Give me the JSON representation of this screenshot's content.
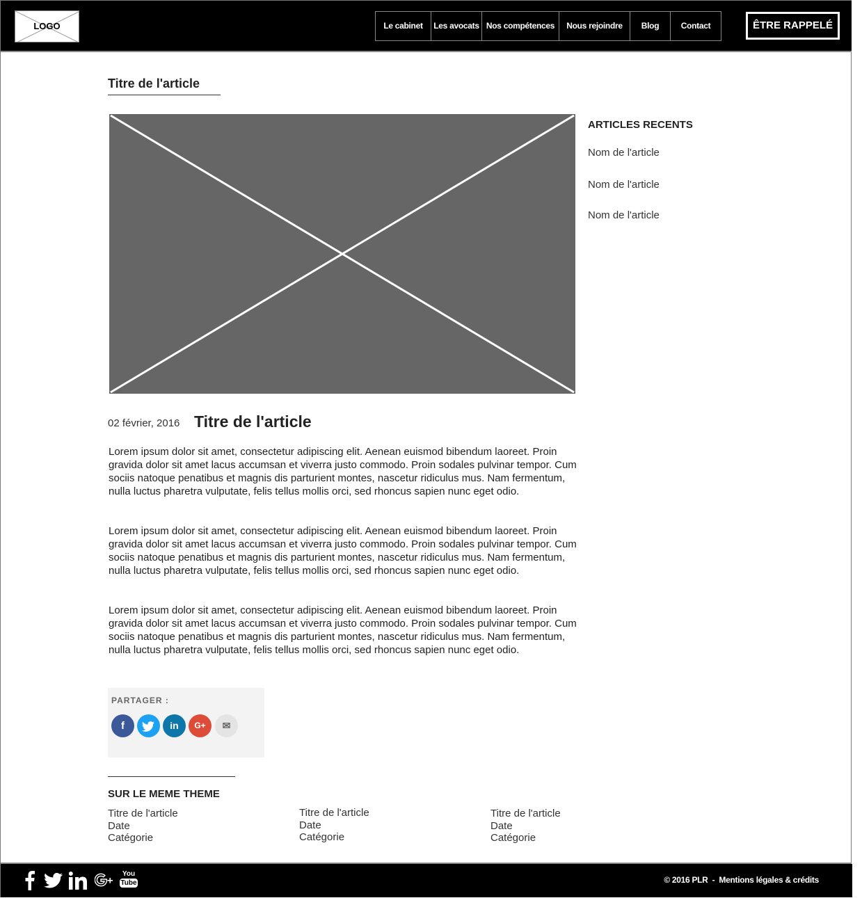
{
  "header": {
    "logo_text": "LOGO",
    "nav": [
      "Le cabinet",
      "Les avocats",
      "Nos compétences",
      "Nous rejoindre",
      "Blog",
      "Contact"
    ],
    "cta": "ÊTRE RAPPELÉ"
  },
  "page_title": "Titre de l'article",
  "sidebar": {
    "title": "ARTICLES RECENTS",
    "items": [
      "Nom de l'article",
      "Nom de l'article",
      "Nom de l'article"
    ]
  },
  "article": {
    "date": "02 février, 2016",
    "title": "Titre de l'article",
    "paragraphs": [
      "Lorem ipsum dolor sit amet, consectetur adipiscing elit. Aenean euismod bibendum laoreet. Proin gravida dolor sit amet lacus accumsan et viverra justo commodo. Proin sodales pulvinar tempor. Cum sociis natoque penatibus et magnis dis parturient montes, nascetur ridiculus mus. Nam fermentum, nulla luctus pharetra vulputate, felis tellus mollis orci, sed rhoncus sapien nunc eget odio.",
      "Lorem ipsum dolor sit amet, consectetur adipiscing elit. Aenean euismod bibendum laoreet. Proin gravida dolor sit amet lacus accumsan et viverra justo commodo. Proin sodales pulvinar tempor. Cum sociis natoque penatibus et magnis dis parturient montes, nascetur ridiculus mus. Nam fermentum, nulla luctus pharetra vulputate, felis tellus mollis orci, sed rhoncus sapien nunc eget odio.",
      "Lorem ipsum dolor sit amet, consectetur adipiscing elit. Aenean euismod bibendum laoreet. Proin gravida dolor sit amet lacus accumsan et viverra justo commodo. Proin sodales pulvinar tempor. Cum sociis natoque penatibus et magnis dis parturient montes, nascetur ridiculus mus. Nam fermentum, nulla luctus pharetra vulputate, felis tellus mollis orci, sed rhoncus sapien nunc eget odio."
    ]
  },
  "share": {
    "label": "PARTAGER :",
    "buttons": [
      {
        "icon": "facebook-icon",
        "glyph": "f",
        "color": "#3b5998"
      },
      {
        "icon": "twitter-icon",
        "glyph": "t",
        "color": "#1da1f2"
      },
      {
        "icon": "linkedin-icon",
        "glyph": "in",
        "color": "#0e76a8"
      },
      {
        "icon": "google-plus-icon",
        "glyph": "G+",
        "color": "#dd4b39"
      },
      {
        "icon": "email-icon",
        "glyph": "✉",
        "color": "#e4e4e4"
      }
    ]
  },
  "related": {
    "title": "SUR LE MEME THEME",
    "items": [
      {
        "title": "Titre de l'article",
        "date": "Date",
        "category": "Catégorie"
      },
      {
        "title": "Titre de l'article",
        "date": "Date",
        "category": "Catégorie"
      },
      {
        "title": "Titre de l'article",
        "date": "Date",
        "category": "Catégorie"
      }
    ]
  },
  "footer": {
    "social_icons": [
      "facebook-icon",
      "twitter-icon",
      "linkedin-icon",
      "google-plus-icon",
      "youtube-icon"
    ],
    "youtube_top": "You",
    "youtube_bottom": "Tube",
    "copyright": "© 2016 PLR",
    "separator": "-",
    "legal_link": "Mentions légales & crédits"
  },
  "colors": {
    "header_bg": "#000000",
    "hero_placeholder": "#666666",
    "share_bg": "#f3f3f3"
  }
}
